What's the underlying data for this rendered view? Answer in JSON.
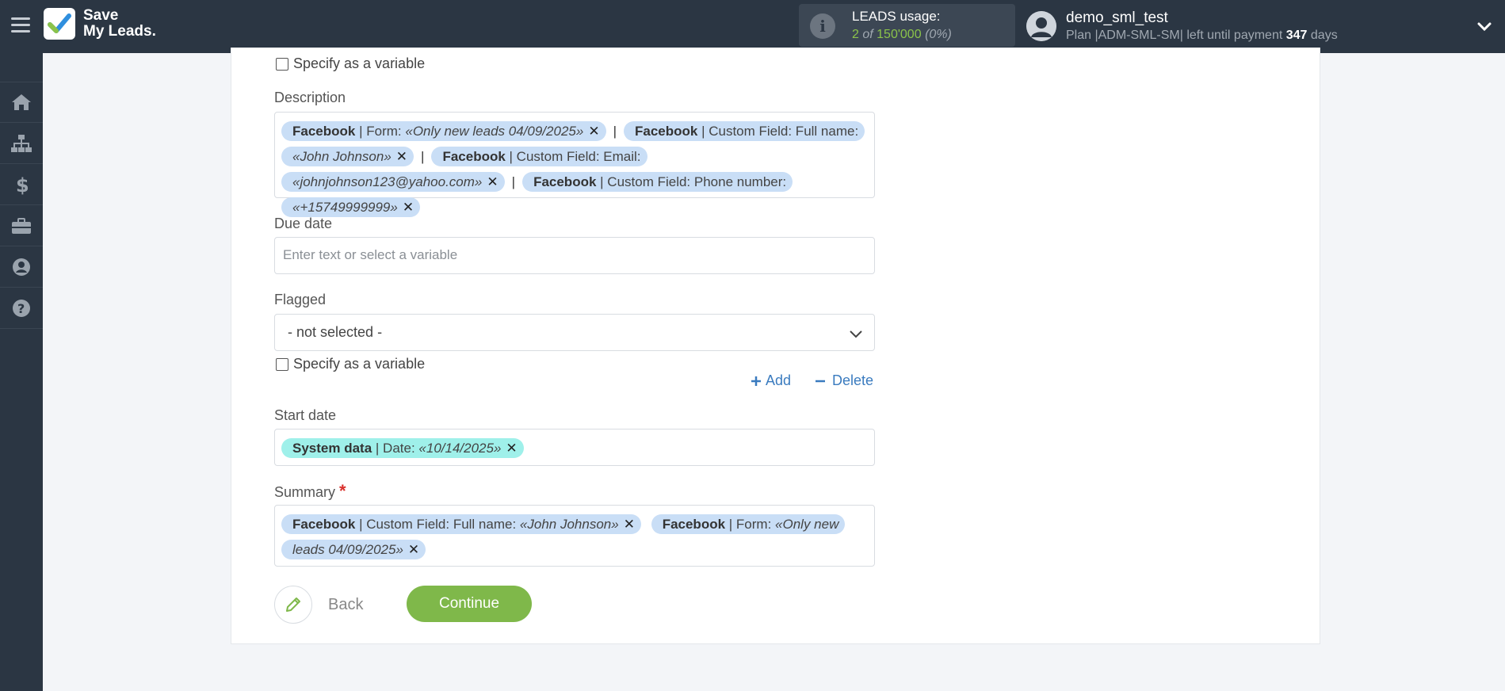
{
  "header": {
    "logo_line1": "Save",
    "logo_line2": "My Leads.",
    "usage_title": "LEADS usage:",
    "usage_count": "2",
    "usage_of": "of",
    "usage_total": "150'000",
    "usage_pct": "(0%)",
    "user_name": "demo_sml_test",
    "plan_prefix": "Plan |ADM-SML-SM| left until payment",
    "plan_days": "347",
    "plan_suffix": "days"
  },
  "sidebar": {
    "items": [
      "home-icon",
      "sitemap-icon",
      "dollar-icon",
      "briefcase-icon",
      "user-icon",
      "help-icon"
    ]
  },
  "form": {
    "specify_variable": "Specify as a variable",
    "description": {
      "label": "Description",
      "tags": [
        {
          "source": "Facebook",
          "field": "| Form:",
          "value": "«Only new leads 04/09/2025»"
        },
        {
          "source": "Facebook",
          "field": "| Custom Field: Full name:",
          "value": "«John Johnson»"
        },
        {
          "source": "Facebook",
          "field": "| Custom Field: Email:",
          "value": "«johnjohnson123@yahoo.com»"
        },
        {
          "source": "Facebook",
          "field": "| Custom Field: Phone number:",
          "value": "«+15749999999»"
        }
      ],
      "separator": "|"
    },
    "due_date": {
      "label": "Due date",
      "placeholder": "Enter text or select a variable"
    },
    "flagged": {
      "label": "Flagged",
      "selected": "- not selected -"
    },
    "add_label": "Add",
    "delete_label": "Delete",
    "start_date": {
      "label": "Start date",
      "tags": [
        {
          "source": "System data",
          "field": "| Date:",
          "value": "«10/14/2025»"
        }
      ]
    },
    "summary": {
      "label": "Summary",
      "required_mark": "*",
      "tags": [
        {
          "source": "Facebook",
          "field": "| Custom Field: Full name:",
          "value": "«John Johnson»"
        },
        {
          "source": "Facebook",
          "field": "| Form:",
          "value": "«Only new leads 04/09/2025»"
        }
      ]
    },
    "back_label": "Back",
    "continue_label": "Continue"
  },
  "colors": {
    "topbar": "#2b3643",
    "tag_blue": "#c9def6",
    "tag_teal": "#9ff0ea",
    "continue_green": "#7fb84a",
    "link_blue": "#3a7bbf"
  }
}
